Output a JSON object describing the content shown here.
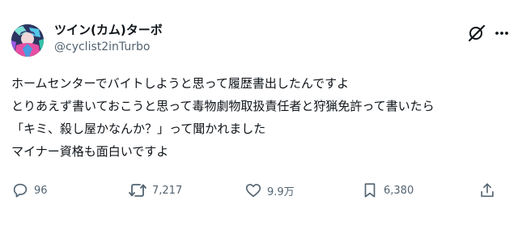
{
  "post": {
    "author": {
      "name": "ツイン(カム)ターボ",
      "handle": "@cyclist2inTurbo"
    },
    "lines": [
      "ホームセンターでバイトしようと思って履歴書出したんですよ",
      "とりあえず書いておこうと思って毒物劇物取扱責任者と狩猟免許って書いたら",
      "「キミ、殺し屋かなんか？」って聞かれました",
      "マイナー資格も面白いですよ"
    ],
    "actions": {
      "replies": "96",
      "reposts": "7,217",
      "likes": "9.9万",
      "bookmarks": "6,380"
    }
  },
  "icons": {
    "avatar": "avatar-illustration",
    "grok": "grok-icon",
    "more": "more-dots-icon",
    "reply": "reply-icon",
    "repost": "repost-icon",
    "like": "heart-icon",
    "bookmark": "bookmark-icon",
    "share": "share-icon"
  },
  "colors": {
    "text": "#0f1419",
    "secondary": "#536471",
    "background": "#ffffff"
  }
}
